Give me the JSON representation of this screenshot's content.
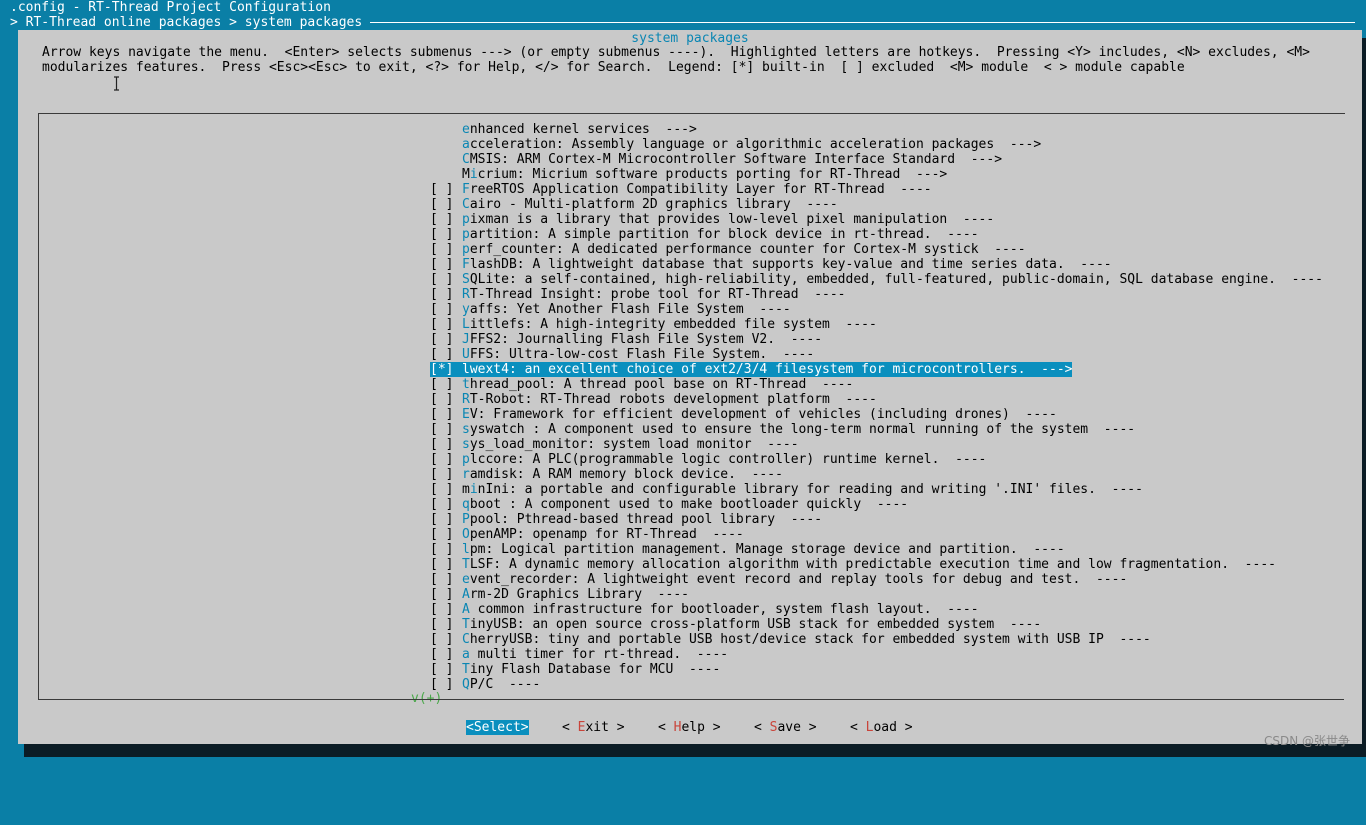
{
  "header": {
    "config_title": ".config - RT-Thread Project Configuration",
    "breadcrumb": "> RT-Thread online packages > system packages"
  },
  "dialog": {
    "title": "system packages",
    "help_line1": "Arrow keys navigate the menu.  <Enter> selects submenus ---> (or empty submenus ----).  Highlighted letters are hotkeys.  Pressing <Y> includes, <N> excludes, <M>",
    "help_line2": "modularizes features.  Press <Esc><Esc> to exit, <?> for Help, </> for Search.  Legend: [*] built-in  [ ] excluded  <M> module  < > module capable"
  },
  "menu": {
    "items": [
      {
        "box": "",
        "hot": "e",
        "rest": "nhanced kernel services  --->"
      },
      {
        "box": "",
        "hot": "a",
        "rest": "cceleration: Assembly language or algorithmic acceleration packages  --->"
      },
      {
        "box": "",
        "hot": "C",
        "rest": "MSIS: ARM Cortex-M Microcontroller Software Interface Standard  --->"
      },
      {
        "box": "",
        "pre": "M",
        "hot": "i",
        "rest": "crium: Micrium software products porting for RT-Thread  --->"
      },
      {
        "box": "[ ]",
        "hot": "F",
        "rest": "reeRTOS Application Compatibility Layer for RT-Thread  ----"
      },
      {
        "box": "[ ]",
        "hot": "C",
        "rest": "airo - Multi-platform 2D graphics library  ----"
      },
      {
        "box": "[ ]",
        "hot": "p",
        "rest": "ixman is a library that provides low-level pixel manipulation  ----"
      },
      {
        "box": "[ ]",
        "hot": "p",
        "rest": "artition: A simple partition for block device in rt-thread.  ----"
      },
      {
        "box": "[ ]",
        "hot": "p",
        "rest": "erf_counter: A dedicated performance counter for Cortex-M systick  ----"
      },
      {
        "box": "[ ]",
        "hot": "F",
        "rest": "lashDB: A lightweight database that supports key-value and time series data.  ----"
      },
      {
        "box": "[ ]",
        "hot": "S",
        "rest": "QLite: a self-contained, high-reliability, embedded, full-featured, public-domain, SQL database engine.  ----"
      },
      {
        "box": "[ ]",
        "hot": "R",
        "rest": "T-Thread Insight: probe tool for RT-Thread  ----"
      },
      {
        "box": "[ ]",
        "hot": "y",
        "rest": "affs: Yet Another Flash File System  ----"
      },
      {
        "box": "[ ]",
        "hot": "L",
        "rest": "ittlefs: A high-integrity embedded file system  ----"
      },
      {
        "box": "[ ]",
        "hot": "J",
        "rest": "FFS2: Journalling Flash File System V2.  ----"
      },
      {
        "box": "[ ]",
        "hot": "U",
        "rest": "FFS: Ultra-low-cost Flash File System.  ----"
      },
      {
        "box": "[*]",
        "hot": "l",
        "rest": "wext4: an excellent choice of ext2/3/4 filesystem for microcontrollers.  --->",
        "selected": true
      },
      {
        "box": "[ ]",
        "hot": "t",
        "rest": "hread_pool: A thread pool base on RT-Thread  ----"
      },
      {
        "box": "[ ]",
        "hot": "R",
        "rest": "T-Robot: RT-Thread robots development platform  ----"
      },
      {
        "box": "[ ]",
        "hot": "E",
        "rest": "V: Framework for efficient development of vehicles (including drones)  ----"
      },
      {
        "box": "[ ]",
        "hot": "s",
        "rest": "yswatch : A component used to ensure the long-term normal running of the system  ----"
      },
      {
        "box": "[ ]",
        "hot": "s",
        "rest": "ys_load_monitor: system load monitor  ----"
      },
      {
        "box": "[ ]",
        "hot": "p",
        "rest": "lccore: A PLC(programmable logic controller) runtime kernel.  ----"
      },
      {
        "box": "[ ]",
        "hot": "r",
        "rest": "amdisk: A RAM memory block device.  ----"
      },
      {
        "box": "[ ]",
        "pre": "m",
        "hot": "i",
        "rest": "nIni: a portable and configurable library for reading and writing '.INI' files.  ----"
      },
      {
        "box": "[ ]",
        "hot": "q",
        "rest": "boot : A component used to make bootloader quickly  ----"
      },
      {
        "box": "[ ]",
        "hot": "P",
        "rest": "pool: Pthread-based thread pool library  ----"
      },
      {
        "box": "[ ]",
        "hot": "O",
        "rest": "penAMP: openamp for RT-Thread  ----"
      },
      {
        "box": "[ ]",
        "hot": "l",
        "rest": "pm: Logical partition management. Manage storage device and partition.  ----"
      },
      {
        "box": "[ ]",
        "hot": "T",
        "rest": "LSF: A dynamic memory allocation algorithm with predictable execution time and low fragmentation.  ----"
      },
      {
        "box": "[ ]",
        "hot": "e",
        "rest": "vent_recorder: A lightweight event record and replay tools for debug and test.  ----"
      },
      {
        "box": "[ ]",
        "hot": "A",
        "rest": "rm-2D Graphics Library  ----"
      },
      {
        "box": "[ ]",
        "hot": "A",
        "rest": " common infrastructure for bootloader, system flash layout.  ----"
      },
      {
        "box": "[ ]",
        "hot": "T",
        "rest": "inyUSB: an open source cross-platform USB stack for embedded system  ----"
      },
      {
        "box": "[ ]",
        "hot": "C",
        "rest": "herryUSB: tiny and portable USB host/device stack for embedded system with USB IP  ----"
      },
      {
        "box": "[ ]",
        "hot": "a",
        "rest": " multi timer for rt-thread.  ----"
      },
      {
        "box": "[ ]",
        "hot": "T",
        "rest": "iny Flash Database for MCU  ----"
      },
      {
        "box": "[ ]",
        "hot": "Q",
        "rest": "P/C  ----"
      }
    ],
    "more_indicator": "v(+)"
  },
  "buttons": {
    "select": {
      "pre": "<",
      "hot": "S",
      "rest": "elect>"
    },
    "exit": {
      "pre": "< ",
      "hot": "E",
      "rest": "xit >"
    },
    "help": {
      "pre": "< ",
      "hot": "H",
      "rest": "elp >"
    },
    "save": {
      "pre": "< ",
      "hot": "S",
      "rest": "ave >"
    },
    "load": {
      "pre": "< ",
      "hot": "L",
      "rest": "oad >"
    }
  },
  "watermark": "CSDN @张世争",
  "colors": {
    "background": "#0a7fa6",
    "dialog": "#c9c9c9",
    "hotkey": "#0a86b3",
    "selection": "#0a8fbe",
    "button_hotkey": "#c9443a"
  }
}
